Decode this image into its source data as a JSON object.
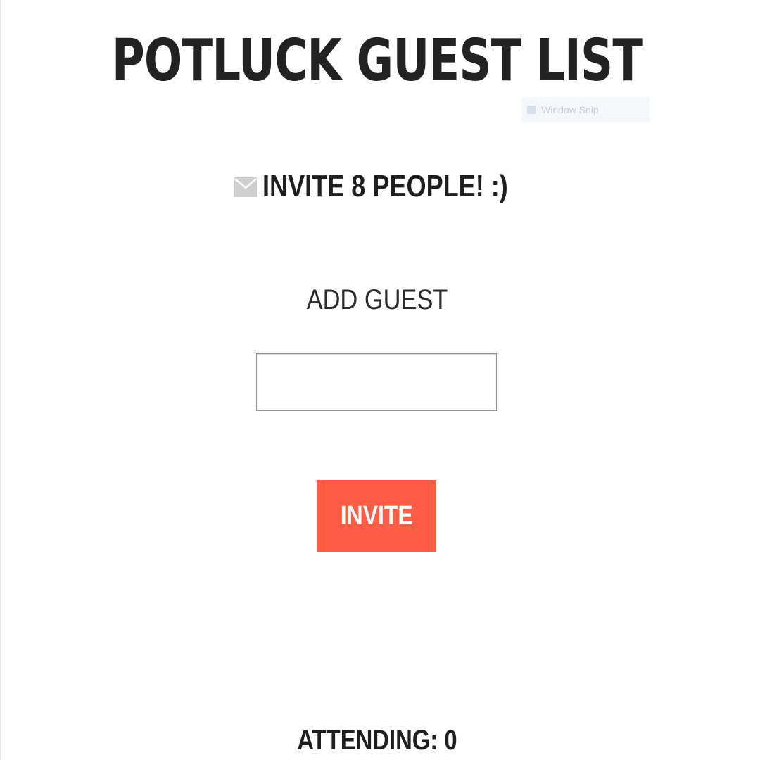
{
  "header": {
    "title": "POTLUCK GUEST LIST"
  },
  "overlay": {
    "snip_text": "Window Snip"
  },
  "invite_banner": {
    "text": "INVITE 8 PEOPLE! :)",
    "icon": "envelope-icon"
  },
  "form": {
    "add_label": "ADD GUEST",
    "input_value": "",
    "input_placeholder": "",
    "invite_button_label": "INVITE"
  },
  "footer": {
    "attending_text": "ATTENDING: 0"
  },
  "colors": {
    "accent": "#fc5d44",
    "text": "#1e1e1e",
    "envelope": "#cfcfcf"
  }
}
